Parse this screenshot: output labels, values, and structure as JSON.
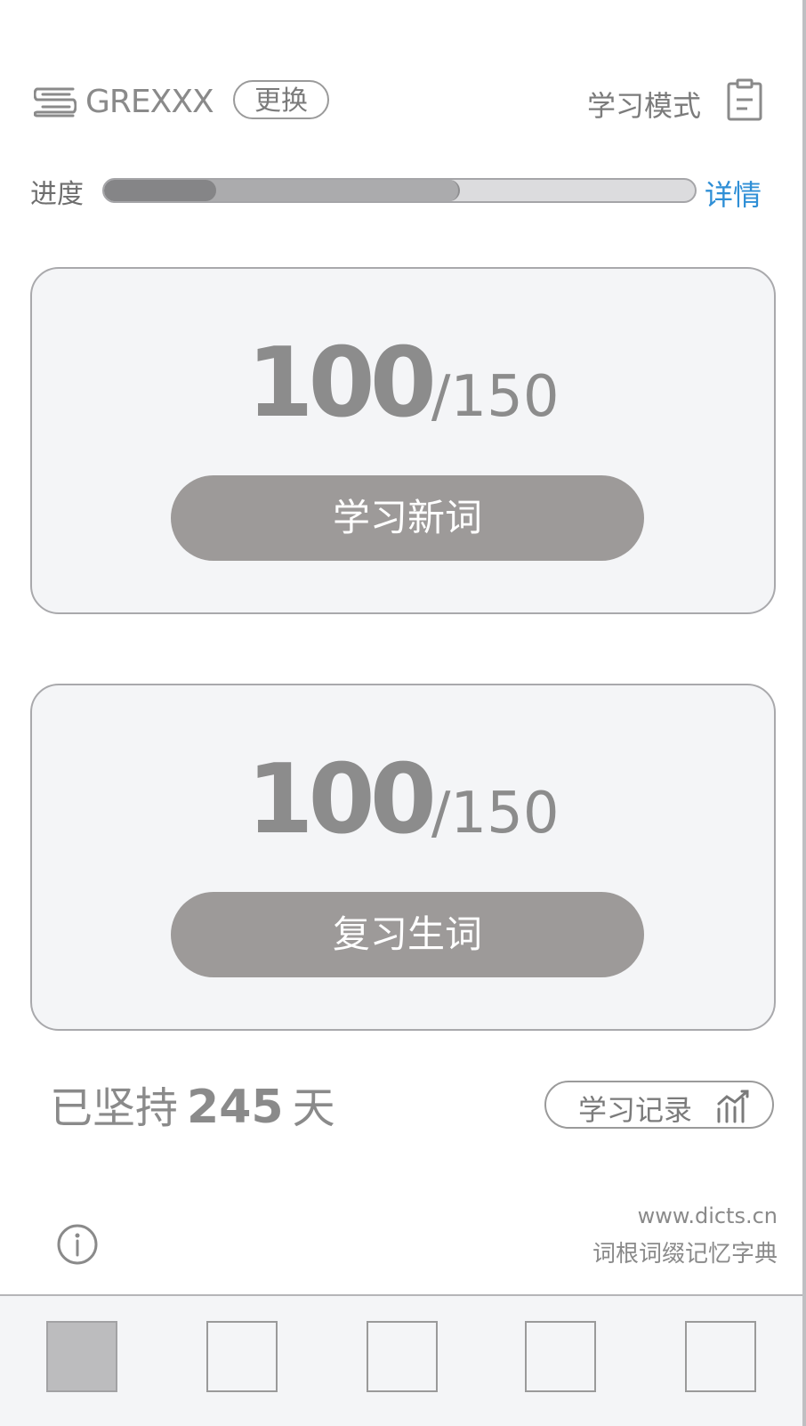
{
  "header": {
    "book_icon": "book-stack-icon",
    "book_title": "GREXXX",
    "change_label": "更换",
    "mode_label": "学习模式",
    "mode_icon": "clipboard-icon"
  },
  "progress": {
    "label": "进度",
    "learned_fraction": 0.19,
    "reviewed_fraction": 0.6,
    "detail_link": "详情",
    "link_color": "#2f8fd6"
  },
  "new_words": {
    "done": "100",
    "separator": "/",
    "total": "150",
    "button_label": "学习新词"
  },
  "review_words": {
    "done": "100",
    "separator": "/",
    "total": "150",
    "button_label": "复习生词"
  },
  "streak": {
    "prefix": "已坚持",
    "days": "245",
    "suffix": "天"
  },
  "record": {
    "label": "学习记录",
    "icon": "bar-chart-icon"
  },
  "footer": {
    "info_icon": "info-icon",
    "site_url": "www.dicts.cn",
    "site_desc": "词根词缀记忆字典"
  },
  "tabbar": {
    "tabs": [
      "tab-1",
      "tab-2",
      "tab-3",
      "tab-4",
      "tab-5"
    ],
    "active_index": 0
  }
}
